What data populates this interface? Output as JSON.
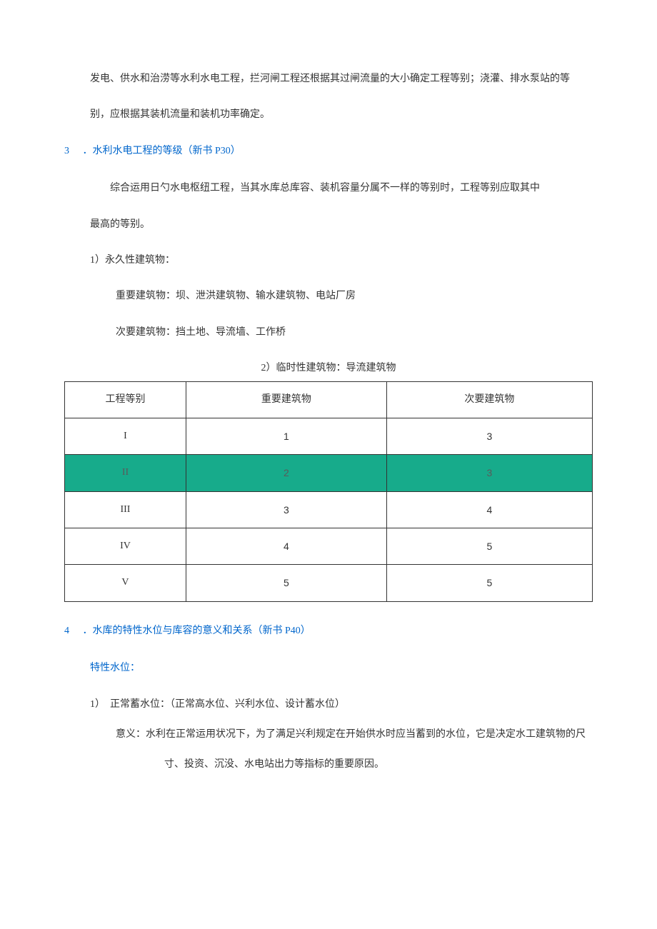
{
  "top_para_line1": "发电、供水和治涝等水利水电工程，拦河闸工程还根据其过闸流量的大小确定工程等别；浇灌、排水泵站的等",
  "top_para_line2": "别，应根据其装机流量和装机功率确定。",
  "section3": {
    "num": "3",
    "title": "．水利水电工程的等级（新书 P30）"
  },
  "s3_para1": "综合运用日勺水电枢纽工程，当其水库总库容、装机容量分属不一样的等别时，工程等别应取其中",
  "s3_para1b": "最高的等别。",
  "s3_item1_label": "1）永久性建筑物：",
  "s3_item1_a": "重要建筑物：坝、泄洪建筑物、输水建筑物、电站厂房",
  "s3_item1_b": "次要建筑物：挡土地、导流墙、工作桥",
  "table_title": "2）临时性建筑物：导流建筑物",
  "table": {
    "headers": [
      "工程等别",
      "重要建筑物",
      "次要建筑物"
    ],
    "rows": [
      {
        "level": "I",
        "major": "1",
        "minor": "3",
        "highlight": false
      },
      {
        "level": "II",
        "major": "2",
        "minor": "3",
        "highlight": true
      },
      {
        "level": "III",
        "major": "3",
        "minor": "4",
        "highlight": false
      },
      {
        "level": "IV",
        "major": "4",
        "minor": "5",
        "highlight": false
      },
      {
        "level": "V",
        "major": "5",
        "minor": "5",
        "highlight": false
      }
    ]
  },
  "section4": {
    "num": "4",
    "title": "．水库的特性水位与库容的意义和关系（新书 P40）"
  },
  "s4_sublabel": "特性水位：",
  "s4_item1_label": "1）　正常蓄水位：（正常高水位、兴利水位、设计蓄水位）",
  "s4_item1_meaning": "意义：水利在正常运用状况下，为了满足兴利规定在开始供水时应当蓄到的水位，它是决定水工建筑物的尺",
  "s4_item1_meaning2": "寸、投资、沉没、水电站出力等指标的重要原因。"
}
